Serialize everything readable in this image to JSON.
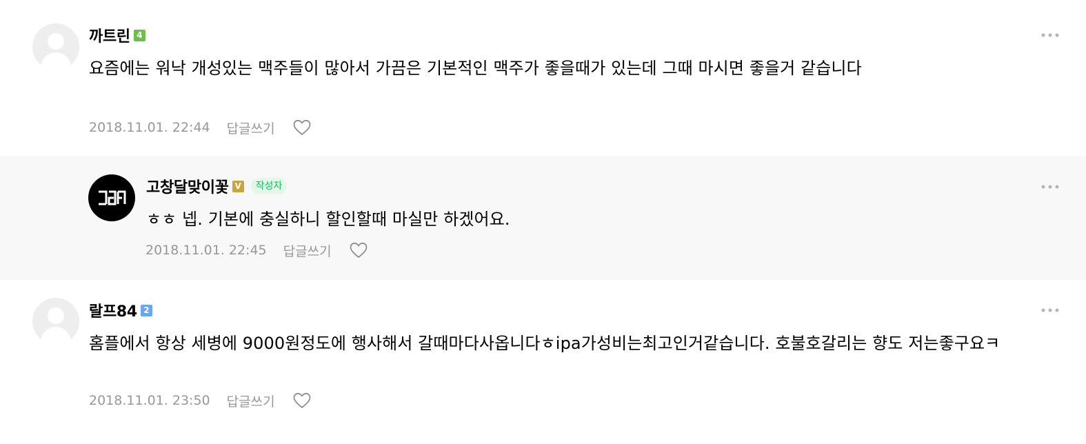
{
  "comments": [
    {
      "nickname": "까트린",
      "level": "4",
      "level_color": "#6cc04a",
      "text": "요즘에는 워낙 개성있는 맥주들이 많아서 가끔은 기본적인 맥주가 좋을때가 있는데 그때 마시면 좋을거 같습니다",
      "date": "2018.11.01. 22:44",
      "reply_label": "답글쓰기",
      "avatar_icon": "default-profile-icon"
    },
    {
      "nickname": "고창달맞이꽃",
      "level": "V",
      "level_color": "#c8a53d",
      "author_tag": "작성자",
      "text": "ㅎㅎ 넵. 기본에 충실하니 할인할때 마실만 하겠어요.",
      "date": "2018.11.01. 22:45",
      "reply_label": "답글쓰기",
      "avatar_icon": "brand-logo-avatar"
    },
    {
      "nickname": "랄프84",
      "level": "2",
      "level_color": "#6aa6f2",
      "text": "홈플에서 항상 세병에 9000원정도에 행사해서 갈때마다사옵니다ㅎipa가성비는최고인거같습니다. 호불호갈리는 향도 저는좋구요ㅋ",
      "date": "2018.11.01. 23:50",
      "reply_label": "답글쓰기",
      "avatar_icon": "default-profile-icon"
    }
  ],
  "colors": {
    "reply_background": "#f8f8f8",
    "meta_text": "#979797",
    "author_tag_text": "#03c75a",
    "author_tag_background": "#e6f6ea"
  },
  "icons": {
    "like": "heart-outline-icon",
    "more": "more-dots-icon"
  }
}
